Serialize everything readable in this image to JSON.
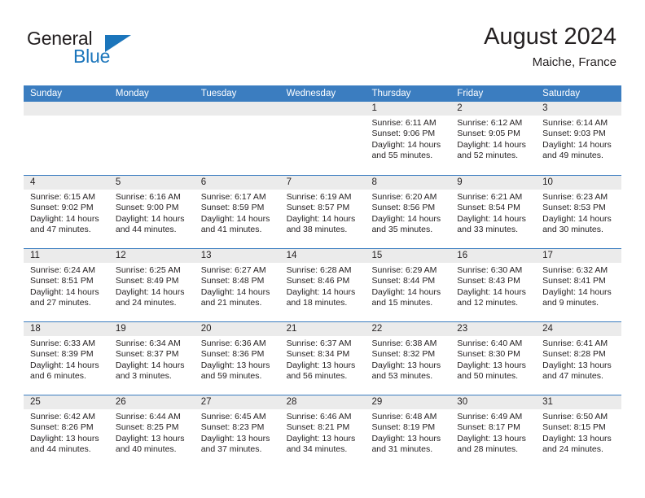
{
  "brand": {
    "name_part1": "General",
    "name_part2": "Blue",
    "flag_icon": "blue-triangle-flag"
  },
  "header": {
    "title": "August 2024",
    "subtitle": "Maiche, France"
  },
  "colors": {
    "header_blue": "#3b7dc0",
    "brand_blue": "#1b75bb",
    "day_number_band": "#ebebeb",
    "text": "#231f20"
  },
  "calendar": {
    "weekdays": [
      "Sunday",
      "Monday",
      "Tuesday",
      "Wednesday",
      "Thursday",
      "Friday",
      "Saturday"
    ],
    "weeks": [
      [
        {
          "day": "",
          "empty": true
        },
        {
          "day": "",
          "empty": true
        },
        {
          "day": "",
          "empty": true
        },
        {
          "day": "",
          "empty": true
        },
        {
          "day": "1",
          "sunrise": "Sunrise: 6:11 AM",
          "sunset": "Sunset: 9:06 PM",
          "daylight": "Daylight: 14 hours and 55 minutes."
        },
        {
          "day": "2",
          "sunrise": "Sunrise: 6:12 AM",
          "sunset": "Sunset: 9:05 PM",
          "daylight": "Daylight: 14 hours and 52 minutes."
        },
        {
          "day": "3",
          "sunrise": "Sunrise: 6:14 AM",
          "sunset": "Sunset: 9:03 PM",
          "daylight": "Daylight: 14 hours and 49 minutes."
        }
      ],
      [
        {
          "day": "4",
          "sunrise": "Sunrise: 6:15 AM",
          "sunset": "Sunset: 9:02 PM",
          "daylight": "Daylight: 14 hours and 47 minutes."
        },
        {
          "day": "5",
          "sunrise": "Sunrise: 6:16 AM",
          "sunset": "Sunset: 9:00 PM",
          "daylight": "Daylight: 14 hours and 44 minutes."
        },
        {
          "day": "6",
          "sunrise": "Sunrise: 6:17 AM",
          "sunset": "Sunset: 8:59 PM",
          "daylight": "Daylight: 14 hours and 41 minutes."
        },
        {
          "day": "7",
          "sunrise": "Sunrise: 6:19 AM",
          "sunset": "Sunset: 8:57 PM",
          "daylight": "Daylight: 14 hours and 38 minutes."
        },
        {
          "day": "8",
          "sunrise": "Sunrise: 6:20 AM",
          "sunset": "Sunset: 8:56 PM",
          "daylight": "Daylight: 14 hours and 35 minutes."
        },
        {
          "day": "9",
          "sunrise": "Sunrise: 6:21 AM",
          "sunset": "Sunset: 8:54 PM",
          "daylight": "Daylight: 14 hours and 33 minutes."
        },
        {
          "day": "10",
          "sunrise": "Sunrise: 6:23 AM",
          "sunset": "Sunset: 8:53 PM",
          "daylight": "Daylight: 14 hours and 30 minutes."
        }
      ],
      [
        {
          "day": "11",
          "sunrise": "Sunrise: 6:24 AM",
          "sunset": "Sunset: 8:51 PM",
          "daylight": "Daylight: 14 hours and 27 minutes."
        },
        {
          "day": "12",
          "sunrise": "Sunrise: 6:25 AM",
          "sunset": "Sunset: 8:49 PM",
          "daylight": "Daylight: 14 hours and 24 minutes."
        },
        {
          "day": "13",
          "sunrise": "Sunrise: 6:27 AM",
          "sunset": "Sunset: 8:48 PM",
          "daylight": "Daylight: 14 hours and 21 minutes."
        },
        {
          "day": "14",
          "sunrise": "Sunrise: 6:28 AM",
          "sunset": "Sunset: 8:46 PM",
          "daylight": "Daylight: 14 hours and 18 minutes."
        },
        {
          "day": "15",
          "sunrise": "Sunrise: 6:29 AM",
          "sunset": "Sunset: 8:44 PM",
          "daylight": "Daylight: 14 hours and 15 minutes."
        },
        {
          "day": "16",
          "sunrise": "Sunrise: 6:30 AM",
          "sunset": "Sunset: 8:43 PM",
          "daylight": "Daylight: 14 hours and 12 minutes."
        },
        {
          "day": "17",
          "sunrise": "Sunrise: 6:32 AM",
          "sunset": "Sunset: 8:41 PM",
          "daylight": "Daylight: 14 hours and 9 minutes."
        }
      ],
      [
        {
          "day": "18",
          "sunrise": "Sunrise: 6:33 AM",
          "sunset": "Sunset: 8:39 PM",
          "daylight": "Daylight: 14 hours and 6 minutes."
        },
        {
          "day": "19",
          "sunrise": "Sunrise: 6:34 AM",
          "sunset": "Sunset: 8:37 PM",
          "daylight": "Daylight: 14 hours and 3 minutes."
        },
        {
          "day": "20",
          "sunrise": "Sunrise: 6:36 AM",
          "sunset": "Sunset: 8:36 PM",
          "daylight": "Daylight: 13 hours and 59 minutes."
        },
        {
          "day": "21",
          "sunrise": "Sunrise: 6:37 AM",
          "sunset": "Sunset: 8:34 PM",
          "daylight": "Daylight: 13 hours and 56 minutes."
        },
        {
          "day": "22",
          "sunrise": "Sunrise: 6:38 AM",
          "sunset": "Sunset: 8:32 PM",
          "daylight": "Daylight: 13 hours and 53 minutes."
        },
        {
          "day": "23",
          "sunrise": "Sunrise: 6:40 AM",
          "sunset": "Sunset: 8:30 PM",
          "daylight": "Daylight: 13 hours and 50 minutes."
        },
        {
          "day": "24",
          "sunrise": "Sunrise: 6:41 AM",
          "sunset": "Sunset: 8:28 PM",
          "daylight": "Daylight: 13 hours and 47 minutes."
        }
      ],
      [
        {
          "day": "25",
          "sunrise": "Sunrise: 6:42 AM",
          "sunset": "Sunset: 8:26 PM",
          "daylight": "Daylight: 13 hours and 44 minutes."
        },
        {
          "day": "26",
          "sunrise": "Sunrise: 6:44 AM",
          "sunset": "Sunset: 8:25 PM",
          "daylight": "Daylight: 13 hours and 40 minutes."
        },
        {
          "day": "27",
          "sunrise": "Sunrise: 6:45 AM",
          "sunset": "Sunset: 8:23 PM",
          "daylight": "Daylight: 13 hours and 37 minutes."
        },
        {
          "day": "28",
          "sunrise": "Sunrise: 6:46 AM",
          "sunset": "Sunset: 8:21 PM",
          "daylight": "Daylight: 13 hours and 34 minutes."
        },
        {
          "day": "29",
          "sunrise": "Sunrise: 6:48 AM",
          "sunset": "Sunset: 8:19 PM",
          "daylight": "Daylight: 13 hours and 31 minutes."
        },
        {
          "day": "30",
          "sunrise": "Sunrise: 6:49 AM",
          "sunset": "Sunset: 8:17 PM",
          "daylight": "Daylight: 13 hours and 28 minutes."
        },
        {
          "day": "31",
          "sunrise": "Sunrise: 6:50 AM",
          "sunset": "Sunset: 8:15 PM",
          "daylight": "Daylight: 13 hours and 24 minutes."
        }
      ]
    ]
  }
}
